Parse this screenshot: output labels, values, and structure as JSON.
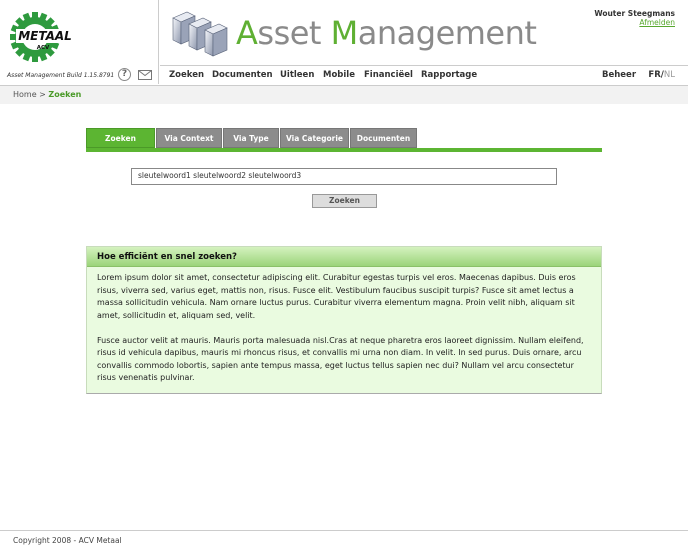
{
  "app": {
    "logo_text": "METAAL",
    "logo_subtext": "ACV",
    "build": "Asset Management Build 1.15.8791",
    "title_part1": "A",
    "title_part2": "sset ",
    "title_part3": "M",
    "title_part4": "anagement"
  },
  "user": {
    "name": "Wouter Steegmans",
    "logout_label": "Afmelden"
  },
  "nav": {
    "items": [
      "Zoeken",
      "Documenten",
      "Uitleen",
      "Mobile",
      "Financiëel",
      "Rapportage"
    ],
    "admin_label": "Beheer",
    "lang_fr": "FR",
    "lang_sep": "/",
    "lang_nl": "NL"
  },
  "breadcrumb": {
    "home": "Home",
    "separator": ">",
    "current": "Zoeken"
  },
  "tabs": [
    "Zoeken",
    "Via Context",
    "Via Type",
    "Via Categorie",
    "Documenten"
  ],
  "search": {
    "value": "sleutelwoord1 sleutelwoord2 sleutelwoord3",
    "button_label": "Zoeken"
  },
  "info": {
    "title": "Hoe efficiënt en snel zoeken?",
    "paragraph1": "Lorem ipsum dolor sit amet, consectetur adipiscing elit. Curabitur egestas turpis vel eros. Maecenas dapibus. Duis eros risus, viverra sed, varius eget, mattis non, risus. Fusce elit. Vestibulum faucibus suscipit turpis? Fusce sit amet lectus a massa sollicitudin vehicula. Nam ornare luctus purus. Curabitur viverra elementum magna. Proin velit nibh, aliquam sit amet, sollicitudin et, aliquam sed, velit.",
    "paragraph2": "Fusce auctor velit at mauris. Mauris porta malesuada nisl.Cras at neque pharetra eros laoreet dignissim. Nullam eleifend, risus id vehicula dapibus, mauris mi rhoncus risus, et convallis mi urna non diam. In velit. In sed purus. Duis ornare, arcu convallis commodo lobortis, sapien ante tempus massa, eget luctus tellus sapien nec dui? Nullam vel arcu consectetur risus venenatis pulvinar."
  },
  "footer": {
    "copyright": "Copyright 2008 - ACV Metaal"
  },
  "colors": {
    "accent_green": "#5cb532",
    "tab_gray": "#8c8c8c",
    "info_bg": "#eafbe0"
  },
  "icons": {
    "help": "help-icon",
    "mail": "mail-icon",
    "logo": "gear-logo-icon",
    "banner": "cubes-icon"
  }
}
